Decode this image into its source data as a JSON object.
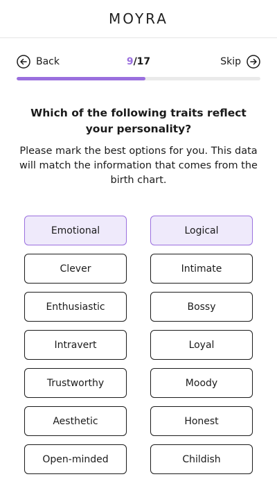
{
  "app": {
    "brand": "MOYRA"
  },
  "nav": {
    "back_label": "Back",
    "skip_label": "Skip",
    "step_current": "9",
    "step_total": "/17",
    "progress_fraction": 0.5294
  },
  "question": {
    "title": "Which of the following traits reflect your personality?",
    "instructions": "Please mark the best options for you. This data will match the information that comes from the birth chart."
  },
  "traits": [
    {
      "label": "Emotional",
      "selected": true
    },
    {
      "label": "Logical",
      "selected": true
    },
    {
      "label": "Clever",
      "selected": false
    },
    {
      "label": "Intimate",
      "selected": false
    },
    {
      "label": "Enthusiastic",
      "selected": false
    },
    {
      "label": "Bossy",
      "selected": false
    },
    {
      "label": "Intravert",
      "selected": false
    },
    {
      "label": "Loyal",
      "selected": false
    },
    {
      "label": "Trustworthy",
      "selected": false
    },
    {
      "label": "Moody",
      "selected": false
    },
    {
      "label": "Aesthetic",
      "selected": false
    },
    {
      "label": "Honest",
      "selected": false
    },
    {
      "label": "Open-minded",
      "selected": false
    },
    {
      "label": "Childish",
      "selected": false
    }
  ],
  "colors": {
    "accent": "#9a6fde",
    "selected_bg": "#efeafb",
    "text": "#1a1a1a",
    "track": "#eaeaea"
  },
  "icons": {
    "back": "arrow-left-circle-icon",
    "skip": "arrow-right-circle-icon"
  }
}
